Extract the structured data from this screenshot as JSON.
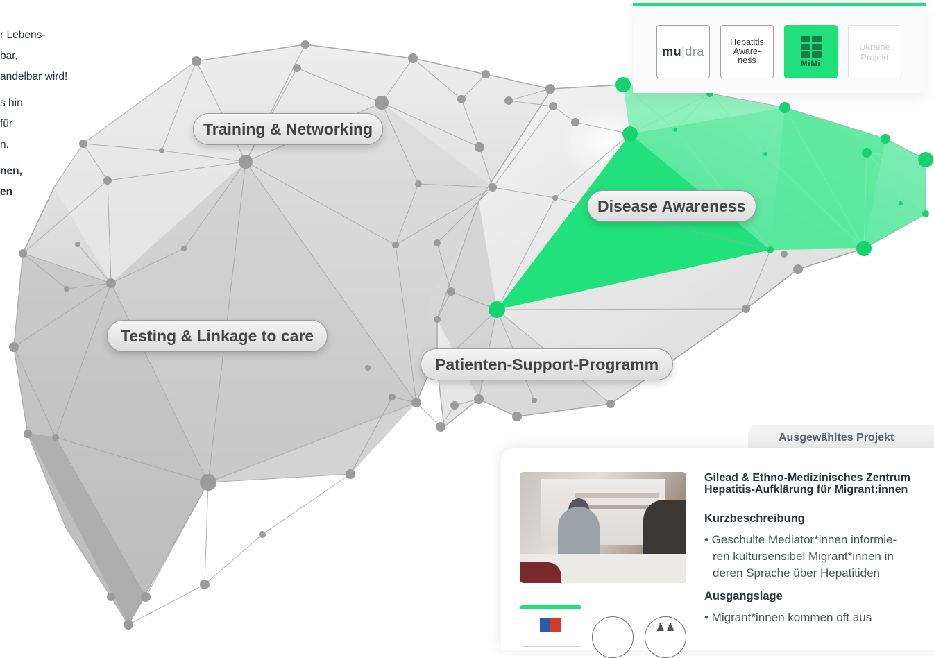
{
  "intro": {
    "line1": "r Lebens-",
    "line2": "bar,",
    "line3": "andelbar wird!",
    "line4": "s hin",
    "line5": "für",
    "line6": "n.",
    "line7": "nen,",
    "line8": "en"
  },
  "areas": {
    "training": "Training & Networking",
    "disease": "Disease Awareness",
    "testing": "Testing & Linkage to care",
    "patient": "Patienten-Support-Programm"
  },
  "logos": {
    "mudra_mu": "mu",
    "mudra_sep": "|",
    "mudra_dra": "dra",
    "hepatitis": [
      "Hepatitis",
      "Aware-",
      "ness"
    ],
    "mimi": "MiMi",
    "ukraine": [
      "Ukraine",
      "Projekt"
    ]
  },
  "project": {
    "tab_label": "Ausgewähltes Projekt",
    "title_line1": "Gilead & Ethno-Medizinisches Zentrum",
    "title_line2": "Hepatitis-Aufklärung  für Migrant:innen",
    "section1_heading": "Kurzbeschreibung",
    "section1_line1": "• Geschulte Mediator*innen informie-",
    "section1_line2": "ren kultursensibel Migrant*innen in",
    "section1_line3": "deren Sprache über Hepatitiden",
    "section2_heading": "Ausgangslage",
    "section2_line1": "• Migrant*innen kommen oft aus"
  },
  "icons": {
    "round_button_2": "people-icon"
  },
  "colors": {
    "accent": "#1fe07a",
    "accent_dark": "#12c768"
  }
}
